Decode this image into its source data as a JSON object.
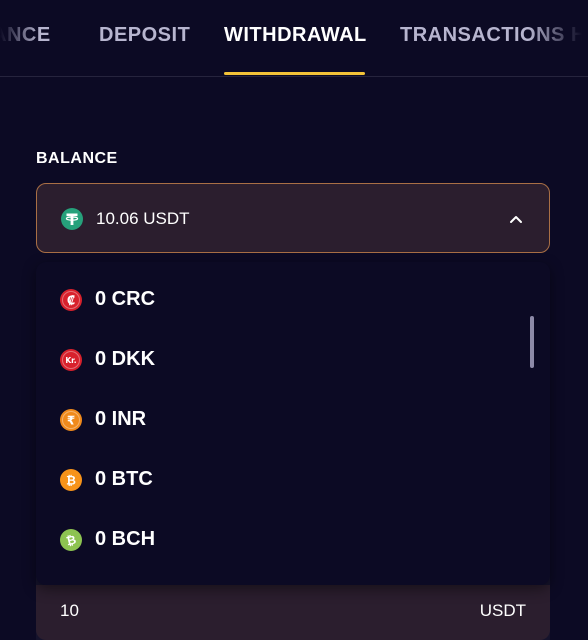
{
  "tabs": [
    {
      "label": "ANCE",
      "active": false
    },
    {
      "label": "DEPOSIT",
      "active": false
    },
    {
      "label": "WITHDRAWAL",
      "active": true
    },
    {
      "label": "TRANSACTIONS H",
      "active": false
    }
  ],
  "balance": {
    "label": "BALANCE",
    "selected": {
      "value": "10.06 USDT",
      "icon": "usdt-icon",
      "color": "#26a17b"
    }
  },
  "dropdown": {
    "items": [
      {
        "label": "0 CRC",
        "icon": "crc-icon",
        "color": "#d8212c",
        "glyph": "₡"
      },
      {
        "label": "0 DKK",
        "icon": "dkk-icon",
        "color": "#d8212c",
        "glyph": "Kr."
      },
      {
        "label": "0 INR",
        "icon": "inr-icon",
        "color": "#f08a1c",
        "glyph": "₹"
      },
      {
        "label": "0 BTC",
        "icon": "btc-icon",
        "color": "#f7931a",
        "glyph": "₿"
      },
      {
        "label": "0 BCH",
        "icon": "bch-icon",
        "color": "#8dc351",
        "glyph": "₿"
      }
    ]
  },
  "amount": {
    "value": "10",
    "unit": "USDT"
  },
  "colors": {
    "background": "#0c0a24",
    "accent": "#f3c338",
    "selector_border": "#a96f45",
    "selector_bg": "#2b1e2e"
  }
}
